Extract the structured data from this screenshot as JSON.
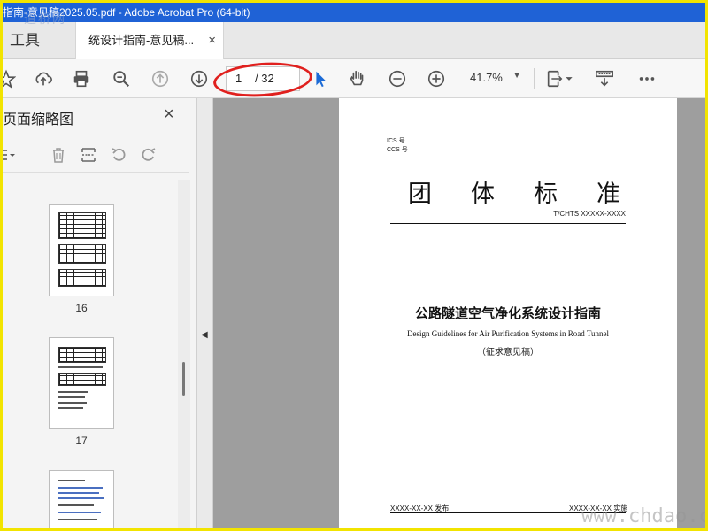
{
  "window": {
    "title": "指南-意见稿2025.05.pdf - Adobe Acrobat Pro (64-bit)"
  },
  "tabs": {
    "tools_label": "工具",
    "document_label": "统设计指南-意见稿...",
    "close_glyph": "×"
  },
  "toolbar": {
    "page_current": "1",
    "page_total": "/ 32",
    "zoom": "41.7%",
    "icons": [
      "star-icon",
      "upload-icon",
      "print-icon",
      "zoom-out-search-icon",
      "page-up-icon",
      "page-down-icon",
      "select-arrow-icon",
      "hand-icon",
      "zoom-minus-icon",
      "zoom-plus-icon",
      "fit-page-icon",
      "scroll-mode-icon",
      "more-icon"
    ]
  },
  "thumbnail_panel": {
    "title": "页面缩略图",
    "close_glyph": "×",
    "thumbnails": [
      {
        "label": "16"
      },
      {
        "label": "17"
      }
    ]
  },
  "document": {
    "ics_line": "ICS 号",
    "ccs_line": "CCS 号",
    "standard_title_chars": [
      "团",
      "体",
      "标",
      "准"
    ],
    "standard_code": "T/CHTS  XXXXX-XXXX",
    "title_cn": "公路隧道空气净化系统设计指南",
    "title_en": "Design Guidelines for Air Purification Systems in Road Tunnel",
    "subtitle": "（征求意见稿）",
    "publish_left": "XXXX-XX-XX  发布",
    "publish_right": "XXXX-XX-XX  实施"
  },
  "watermarks": {
    "top_left": "道桥网",
    "bottom_right": "www.chdao.c"
  },
  "colors": {
    "titlebar": "#1f62d6",
    "frame_border": "#f2e400",
    "annotation_ring": "#e0201e",
    "select_tool": "#1b6ad6"
  }
}
